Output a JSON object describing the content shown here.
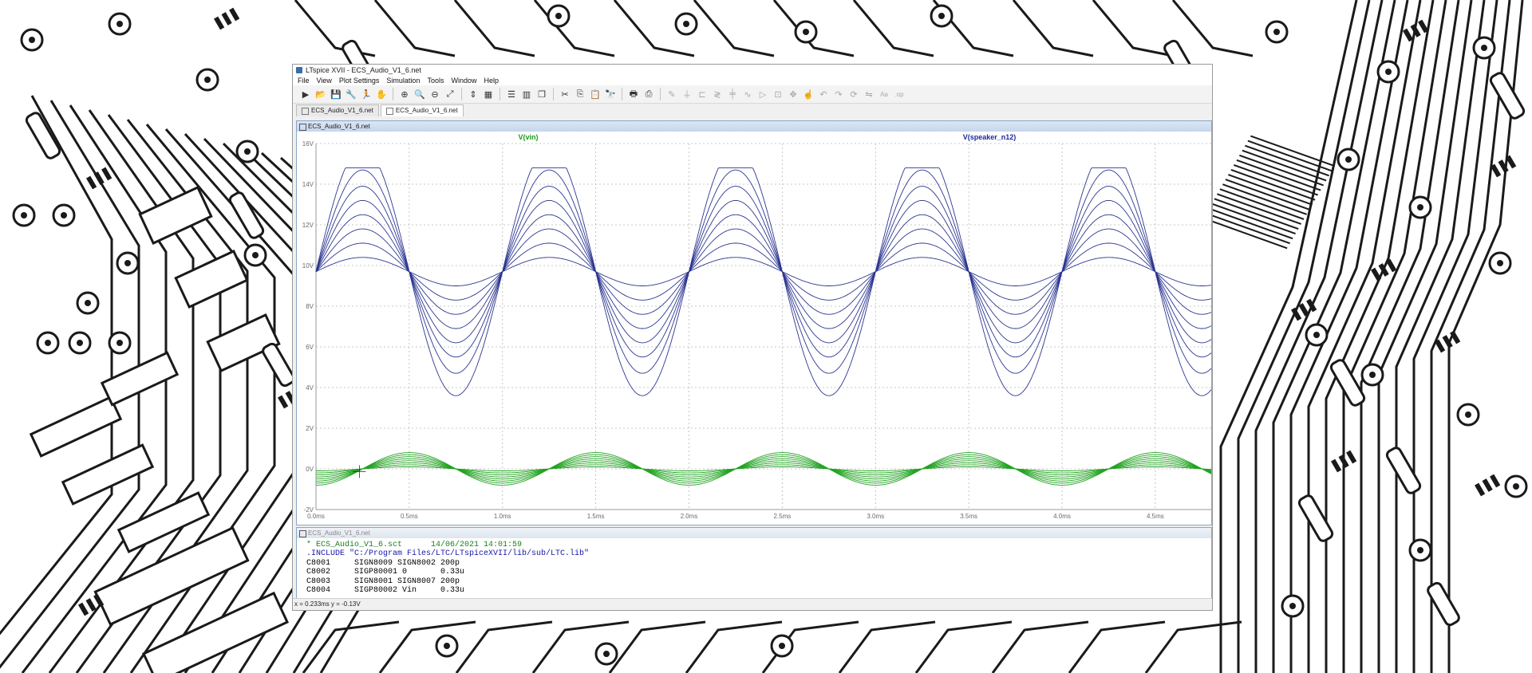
{
  "window": {
    "title": "LTspice XVII - ECS_Audio_V1_6.net"
  },
  "menu": [
    "File",
    "View",
    "Plot Settings",
    "Simulation",
    "Tools",
    "Window",
    "Help"
  ],
  "toolbar_icons": [
    "run-icon",
    "open-icon",
    "save-icon",
    "control-panel-icon",
    "run-man-icon",
    "hand-icon",
    "zoom-in-icon",
    "zoom-area-icon",
    "zoom-out-icon",
    "zoom-fit-icon",
    "autorange-icon",
    "grid-icon",
    "tile-horizontal-icon",
    "tile-vertical-icon",
    "cascade-icon",
    "cut-icon",
    "copy-icon",
    "paste-icon",
    "find-icon",
    "print-icon",
    "print-preview-icon",
    "wire-icon",
    "ground-icon",
    "label-icon",
    "resistor-icon",
    "capacitor-icon",
    "inductor-icon",
    "diode-icon",
    "component-icon",
    "move-icon",
    "drag-icon",
    "undo-icon",
    "redo-icon",
    "rotate-icon",
    "mirror-icon",
    "text-icon",
    "spice-directive-icon"
  ],
  "tabs": [
    {
      "label": "ECS_Audio_V1_6.net",
      "active": false
    },
    {
      "label": "ECS_Audio_V1_6.net",
      "active": true
    }
  ],
  "plot_window": {
    "title": "ECS_Audio_V1_6.net"
  },
  "netlist_window": {
    "title": "ECS_Audio_V1_6.net",
    "lines": [
      {
        "text": "* ECS_Audio_V1_6.sct      14/06/2021 14:01:59",
        "kind": "comment"
      },
      {
        "text": ".INCLUDE \"C:/Program Files/LTC/LTspiceXVII/lib/sub/LTC.lib\"",
        "kind": "directive"
      },
      {
        "text": "C8001     SIGN8009 SIGN8002 200p",
        "kind": "normal"
      },
      {
        "text": "C8002     SIGP80001 0       0.33u",
        "kind": "normal"
      },
      {
        "text": "C8003     SIGN8001 SIGN8007 200p",
        "kind": "normal"
      },
      {
        "text": "C8004     SIGP80002 Vin     0.33u",
        "kind": "normal"
      }
    ]
  },
  "status": {
    "cursor_readout": "x = 0.233ms   y = -0.13V"
  },
  "colors": {
    "vin_trace": "#22a322",
    "speaker_trace": "#2b3590",
    "vin_label": "#1c9a1c",
    "speaker_label": "#1c2aa0",
    "grid": "#b8b8b8",
    "axis_text": "#6a6a6a"
  },
  "chart_data": {
    "type": "line",
    "title": "",
    "xlabel": "",
    "ylabel": "",
    "x_unit": "ms",
    "y_unit": "V",
    "xlim": [
      0,
      4.8
    ],
    "ylim": [
      -2,
      16
    ],
    "x_ticks": [
      "0.0ms",
      "0.5ms",
      "1.0ms",
      "1.5ms",
      "2.0ms",
      "2.5ms",
      "3.0ms",
      "3.5ms",
      "4.0ms",
      "4.5ms"
    ],
    "y_ticks": [
      "-2V",
      "0V",
      "2V",
      "4V",
      "6V",
      "8V",
      "10V",
      "12V",
      "14V",
      "16V"
    ],
    "grid": true,
    "frequency_khz": 1,
    "legend": [
      {
        "name": "V(vin)",
        "color": "#1c9a1c",
        "position": "top-left"
      },
      {
        "name": "V(speaker_n12)",
        "color": "#1c2aa0",
        "position": "top-right"
      }
    ],
    "series": [
      {
        "name": "V(speaker_n12)",
        "kind": "stepped_family",
        "offset": 9.7,
        "amplitudes": [
          0.7,
          1.4,
          2.1,
          2.8,
          3.5,
          4.2,
          5.0,
          6.1
        ],
        "clip_high": 14.8,
        "clip_low": 3.5,
        "phase_start_ms": 0.0
      },
      {
        "name": "V(vin)",
        "kind": "stepped_family",
        "offset": 0.0,
        "amplitudes": [
          0.1,
          0.2,
          0.3,
          0.4,
          0.5,
          0.6,
          0.7,
          0.8
        ],
        "clip_high": null,
        "clip_low": null,
        "phase_start_ms": 0.25
      }
    ]
  }
}
